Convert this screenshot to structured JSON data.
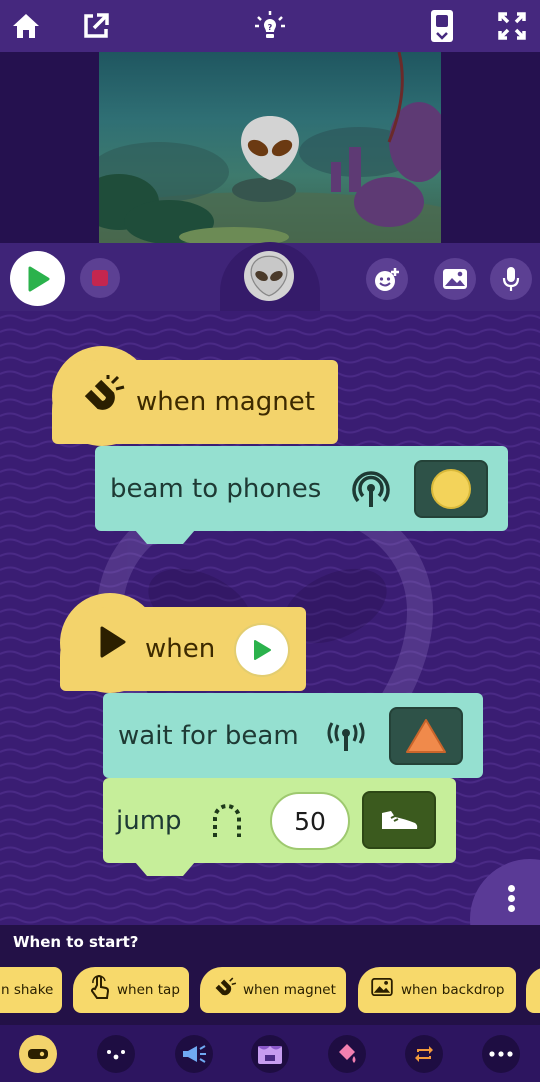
{
  "app": {
    "accent": "#45287e"
  },
  "topbar": {
    "icons": [
      "home-icon",
      "share-icon",
      "hint-lightbulb-icon",
      "device-preview-icon",
      "fullscreen-icon"
    ]
  },
  "stage": {
    "character": "alien"
  },
  "controls": {
    "icons": [
      "play-icon",
      "stop-icon",
      "add-character-icon",
      "backdrop-icon",
      "microphone-icon"
    ]
  },
  "script1": {
    "hat_label": "when magnet",
    "block_label": "beam to phones",
    "beam_color": "#f3d35a"
  },
  "script2": {
    "hat_label": "when",
    "wait_label": "wait for beam",
    "wait_shape": "orange-triangle",
    "jump_label": "jump",
    "jump_value": "50"
  },
  "palette": {
    "title": "When to start?",
    "items": [
      {
        "label": "n shake",
        "icon": ""
      },
      {
        "label": "when tap",
        "icon": "tap-icon"
      },
      {
        "label": "when magnet",
        "icon": "magnet-icon"
      },
      {
        "label": "when backdrop",
        "icon": "backdrop-icon"
      }
    ]
  },
  "bottom_nav": {
    "items": [
      "start-category",
      "sensing-category",
      "sound-category",
      "looks-category",
      "paint-category",
      "control-category",
      "more-category"
    ],
    "selected": "start-category"
  }
}
